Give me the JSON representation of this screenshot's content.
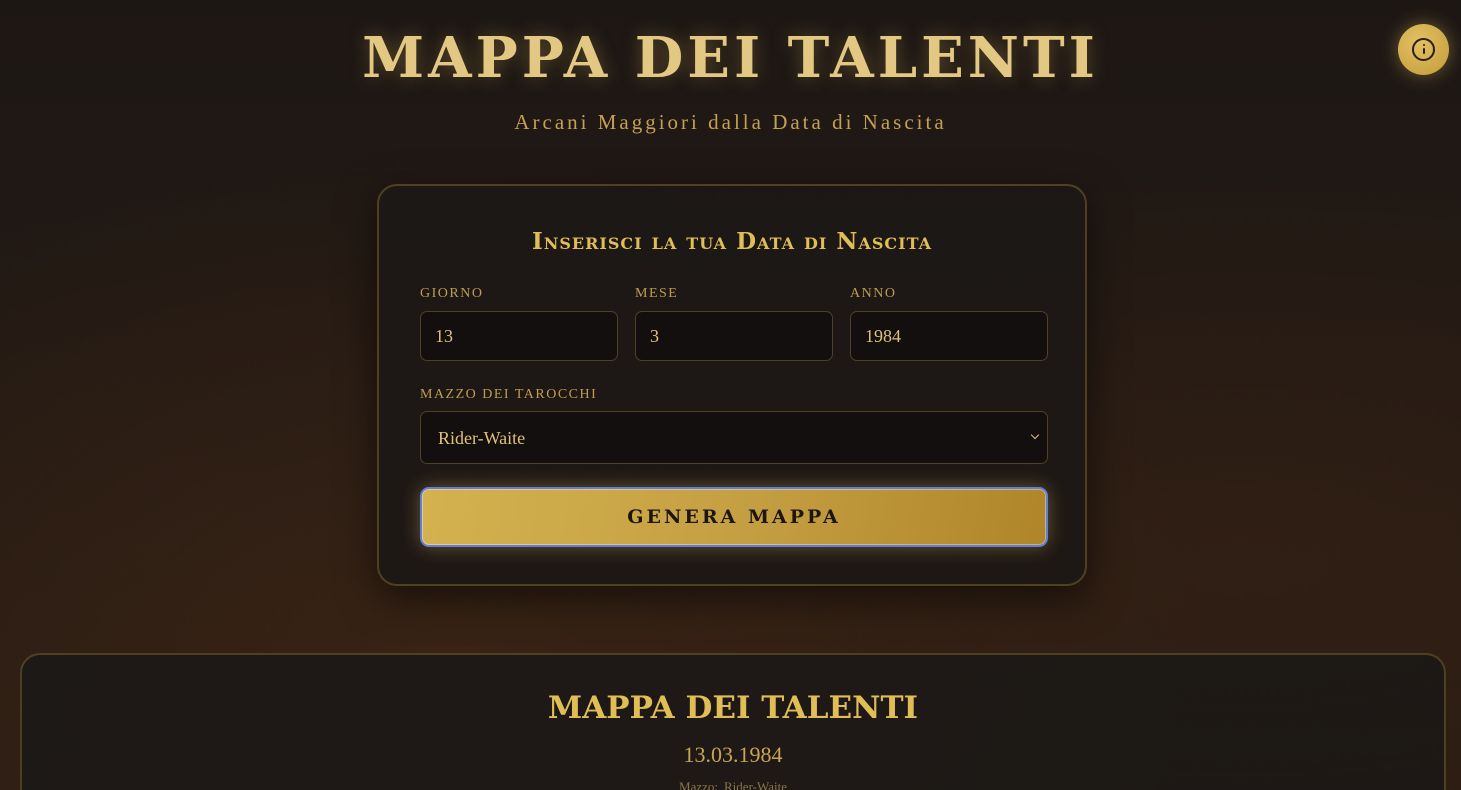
{
  "header": {
    "title": "MAPPA DEI TALENTI",
    "subtitle": "Arcani Maggiori dalla Data di Nascita"
  },
  "info_button": {
    "icon": "info-icon"
  },
  "form": {
    "heading": "Inserisci la tua Data di Nascita",
    "day": {
      "label": "Giorno",
      "value": "13"
    },
    "month": {
      "label": "Mese",
      "value": "3"
    },
    "year": {
      "label": "Anno",
      "value": "1984"
    },
    "deck": {
      "label": "Mazzo dei Tarocchi",
      "selected": "Rider-Waite"
    },
    "submit_label": "GENERA MAPPA"
  },
  "result": {
    "title": "MAPPA DEI TALENTI",
    "date": "13.03.1984",
    "deck_prefix": "Mazzo:",
    "deck_name": "Rider-Waite"
  },
  "colors": {
    "background": "#1d1714",
    "accent_gold": "#d6b25a",
    "button_gold": "#c5a043",
    "focus_ring": "#5d7ee0"
  }
}
